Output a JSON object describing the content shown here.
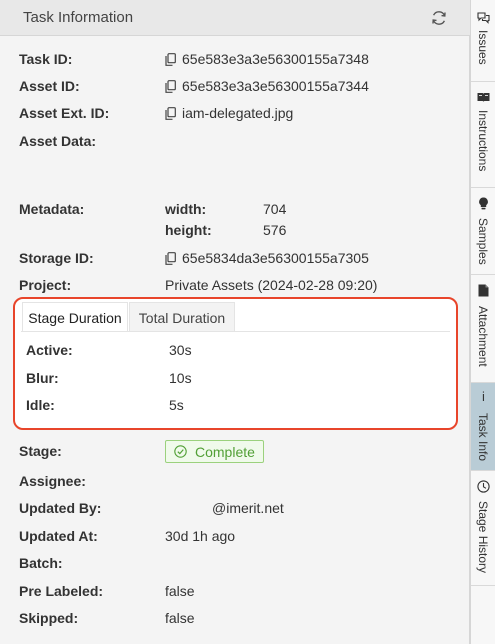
{
  "panel": {
    "title": "Task Information"
  },
  "fields": {
    "task_id": {
      "label": "Task ID:",
      "value": "65e583e3a3e56300155a7348"
    },
    "asset_id": {
      "label": "Asset ID:",
      "value": "65e583e3a3e56300155a7344"
    },
    "asset_ext_id": {
      "label": "Asset Ext. ID:",
      "value": "iam-delegated.jpg"
    },
    "asset_data": {
      "label": "Asset Data:"
    },
    "metadata": {
      "label": "Metadata:",
      "items": [
        {
          "key": "width:",
          "value": "704"
        },
        {
          "key": "height:",
          "value": "576"
        }
      ]
    },
    "storage_id": {
      "label": "Storage ID:",
      "value": "65e5834da3e56300155a7305"
    },
    "project": {
      "label": "Project:",
      "value": "Private Assets (2024-02-28 09:20)"
    }
  },
  "stage_duration": {
    "tabs": [
      "Stage Duration",
      "Total Duration"
    ],
    "active_tab": "Stage Duration",
    "rows": [
      {
        "label": "Active:",
        "value": "30s"
      },
      {
        "label": "Blur:",
        "value": "10s"
      },
      {
        "label": "Idle:",
        "value": "5s"
      }
    ]
  },
  "details": {
    "stage": {
      "label": "Stage:",
      "value": "Complete",
      "color": "#52a036"
    },
    "assignee": {
      "label": "Assignee:"
    },
    "updated_by": {
      "label": "Updated By:",
      "value": "@imerit.net"
    },
    "updated_at": {
      "label": "Updated At:",
      "value": "30d 1h ago"
    },
    "batch": {
      "label": "Batch:"
    },
    "pre_labeled": {
      "label": "Pre Labeled:",
      "value": "false"
    },
    "skipped": {
      "label": "Skipped:",
      "value": "false"
    }
  },
  "sidebar": {
    "items": [
      {
        "label": "Issues",
        "icon": "chat-bubbles-icon"
      },
      {
        "label": "Instructions",
        "icon": "book-icon"
      },
      {
        "label": "Samples",
        "icon": "lightbulb-icon"
      },
      {
        "label": "Attachment",
        "icon": "folder-icon"
      },
      {
        "label": "Task Info",
        "icon": "info-icon",
        "active": true
      },
      {
        "label": "Stage History",
        "icon": "clock-icon"
      }
    ]
  },
  "colors": {
    "highlight_border": "#e8452b",
    "active_sidebar": "#b9ccd6",
    "badge_green": "#52a036"
  }
}
